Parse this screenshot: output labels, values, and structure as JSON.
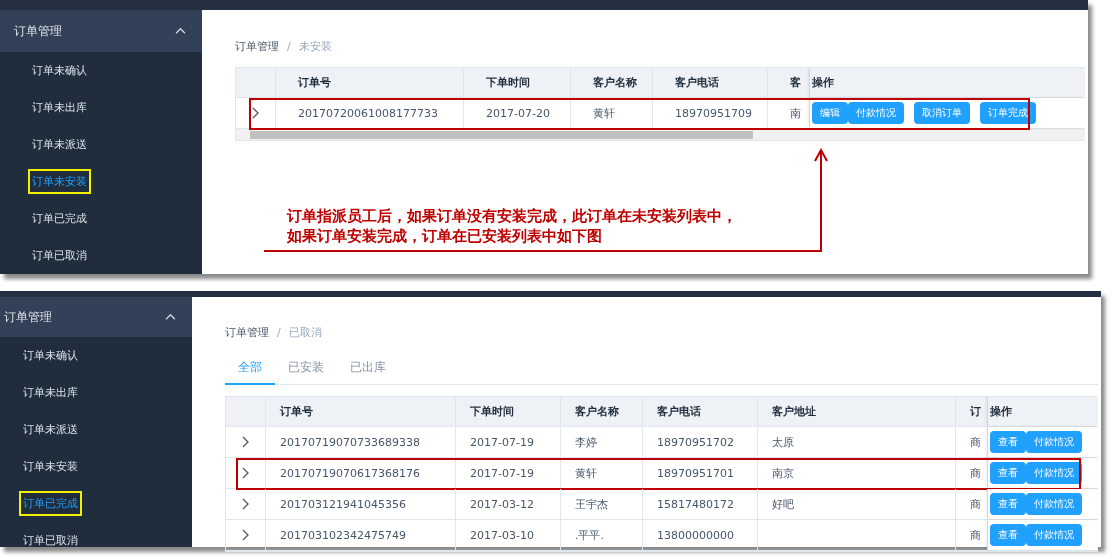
{
  "panels": [
    {
      "sidebar": {
        "group": "订单管理",
        "expanded": true,
        "items": [
          {
            "label": "订单未确认",
            "selected": false,
            "boxed": false
          },
          {
            "label": "订单未出库",
            "selected": false,
            "boxed": false
          },
          {
            "label": "订单未派送",
            "selected": false,
            "boxed": false
          },
          {
            "label": "订单未安装",
            "selected": true,
            "boxed": true
          },
          {
            "label": "订单已完成",
            "selected": false,
            "boxed": false
          },
          {
            "label": "订单已取消",
            "selected": false,
            "boxed": false
          }
        ]
      },
      "breadcrumb": [
        "订单管理",
        "未安装"
      ],
      "breadcrumb_separator": "/",
      "table": {
        "columns": [
          "订单号",
          "下单时间",
          "客户名称",
          "客户电话",
          "客",
          "操作"
        ],
        "rows": [
          {
            "cells": [
              "20170720061008177733",
              "2017-07-20",
              "黄轩",
              "18970951709",
              "南"
            ],
            "actions": [
              "编辑",
              "付款情况",
              "取消订单",
              "订单完成"
            ],
            "boxed": true
          }
        ]
      },
      "annotation": {
        "lines": [
          "订单指派员工后，如果订单没有安装完成，此订单在未安装列表中，",
          "如果订单安装完成，订单在已安装列表中如下图"
        ]
      }
    },
    {
      "sidebar": {
        "group": "订单管理",
        "expanded": true,
        "items": [
          {
            "label": "订单未确认",
            "selected": false,
            "boxed": false
          },
          {
            "label": "订单未出库",
            "selected": false,
            "boxed": false
          },
          {
            "label": "订单未派送",
            "selected": false,
            "boxed": false
          },
          {
            "label": "订单未安装",
            "selected": false,
            "boxed": false
          },
          {
            "label": "订单已完成",
            "selected": true,
            "boxed": true
          },
          {
            "label": "订单已取消",
            "selected": false,
            "boxed": false
          }
        ]
      },
      "breadcrumb": [
        "订单管理",
        "已取消"
      ],
      "breadcrumb_separator": "/",
      "tabs": [
        {
          "label": "全部",
          "selected": true
        },
        {
          "label": "已安装",
          "selected": false
        },
        {
          "label": "已出库",
          "selected": false
        }
      ],
      "table": {
        "columns": [
          "订单号",
          "下单时间",
          "客户名称",
          "客户电话",
          "客户地址",
          "订",
          "操作"
        ],
        "rows": [
          {
            "cells": [
              "20170719070733689338",
              "2017-07-19",
              "李婷",
              "18970951702",
              "太原",
              "商"
            ],
            "actions": [
              "查看",
              "付款情况"
            ],
            "boxed": false
          },
          {
            "cells": [
              "20170719070617368176",
              "2017-07-19",
              "黄轩",
              "18970951701",
              "南京",
              "商"
            ],
            "actions": [
              "查看",
              "付款情况"
            ],
            "boxed": true
          },
          {
            "cells": [
              "201703121941045356",
              "2017-03-12",
              "王宇杰",
              "15817480172",
              "好吧",
              "商"
            ],
            "actions": [
              "查看",
              "付款情况"
            ],
            "boxed": false
          },
          {
            "cells": [
              "201703102342475749",
              "2017-03-10",
              ".平平.",
              "13800000000",
              "",
              "商"
            ],
            "actions": [
              "查看",
              "付款情况"
            ],
            "boxed": false
          }
        ]
      }
    }
  ]
}
